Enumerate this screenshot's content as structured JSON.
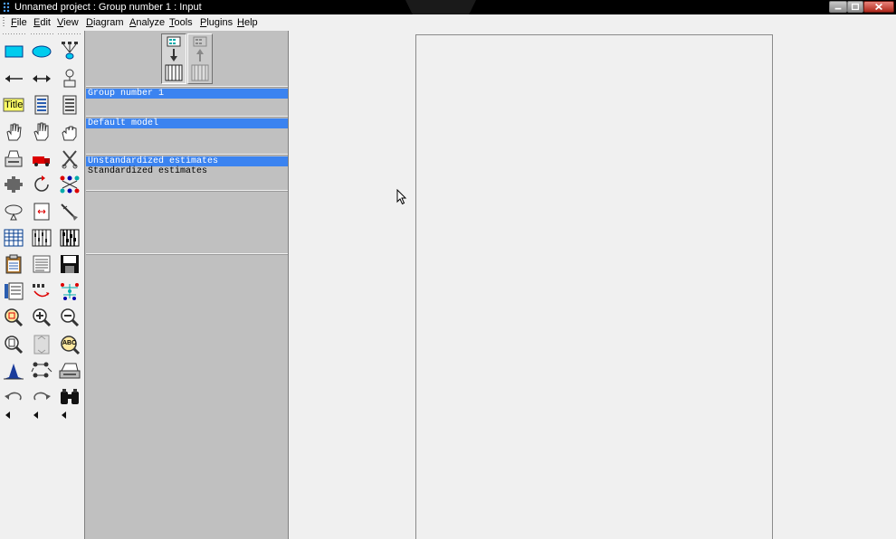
{
  "window": {
    "title": "Unnamed project : Group number 1 : Input"
  },
  "menubar": {
    "items": [
      {
        "key": "F",
        "rest": "ile"
      },
      {
        "key": "E",
        "rest": "dit"
      },
      {
        "key": "V",
        "rest": "iew"
      },
      {
        "key": "D",
        "rest": "iagram"
      },
      {
        "key": "A",
        "rest": "nalyze"
      },
      {
        "key": "T",
        "rest": "ools"
      },
      {
        "key": "P",
        "rest": "lugins"
      },
      {
        "key": "H",
        "rest": "elp"
      }
    ]
  },
  "toolbox": {
    "title_tool_label": "Title",
    "abc_label": "ABC"
  },
  "panels": {
    "groups": [
      "Group number 1"
    ],
    "models": [
      "Default model"
    ],
    "estimates": [
      "Unstandardized estimates",
      "Standardized estimates"
    ]
  },
  "colors": {
    "selection": "#3b83f0",
    "panel": "#c0c0c0",
    "accent_cyan": "#00ccee",
    "title_yellow": "#ffff66"
  }
}
